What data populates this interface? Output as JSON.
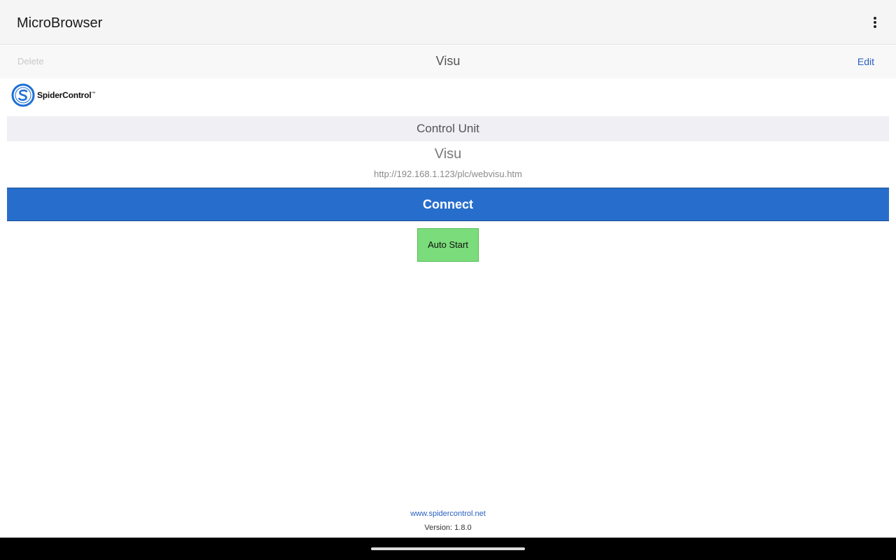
{
  "app_bar": {
    "title": "MicroBrowser",
    "menu_icon": "more-vert-icon"
  },
  "nav_bar": {
    "delete_label": "Delete",
    "title": "Visu",
    "edit_label": "Edit"
  },
  "logo": {
    "text": "SpiderControl",
    "tm": "™"
  },
  "section": {
    "header": "Control Unit"
  },
  "visu": {
    "name": "Visu",
    "url": "http://192.168.1.123/plc/webvisu.htm"
  },
  "actions": {
    "connect_label": "Connect",
    "autostart_label": "Auto Start"
  },
  "footer": {
    "link": "www.spidercontrol.net",
    "version": "Version: 1.8.0"
  },
  "colors": {
    "accent_blue": "#276ecc",
    "autostart_green": "#7adc7a",
    "link_blue": "#2a60c0"
  }
}
